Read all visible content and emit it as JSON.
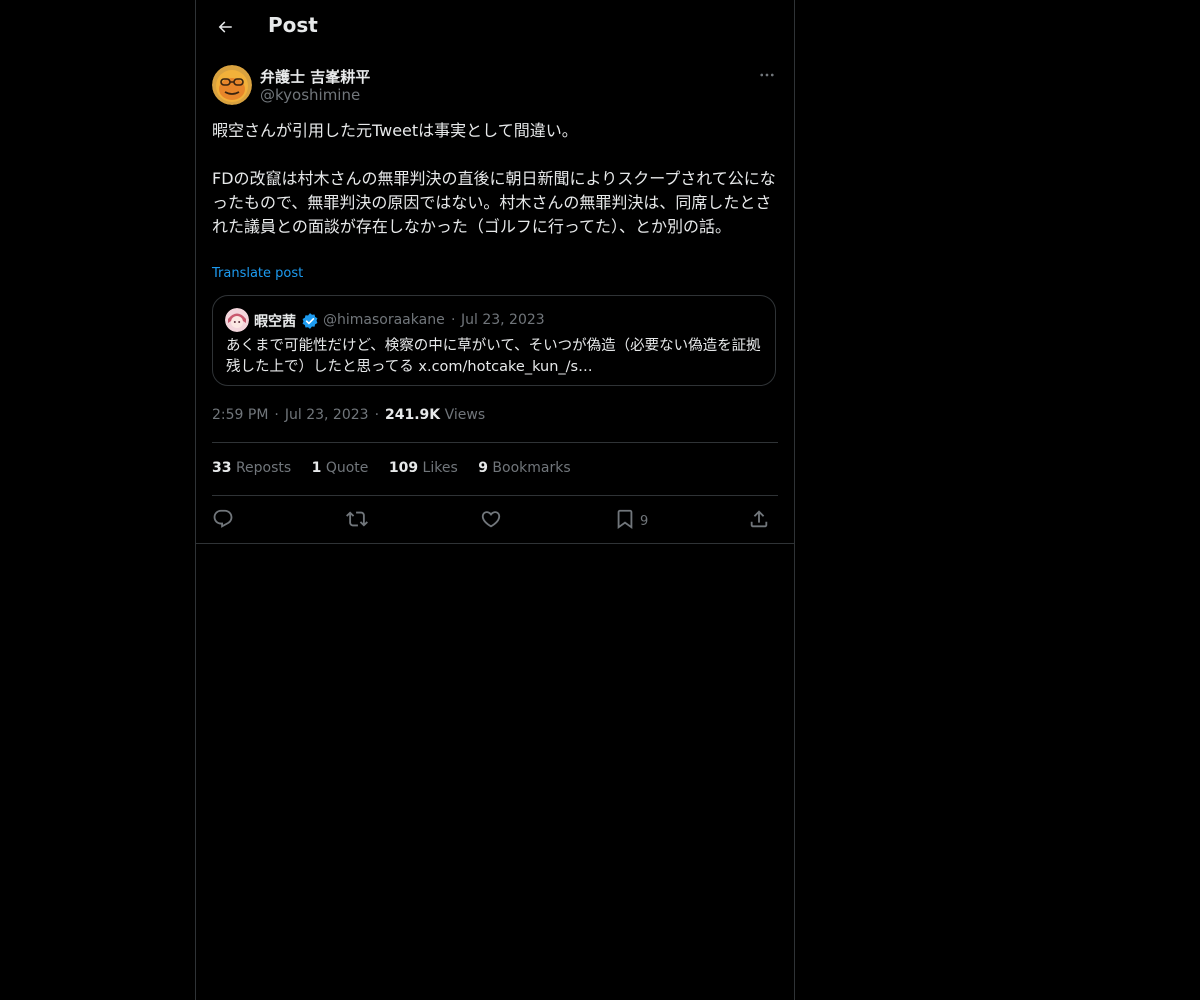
{
  "header": {
    "title": "Post"
  },
  "author": {
    "name": "弁護士 吉峯耕平",
    "handle": "@kyoshimine"
  },
  "tweet": {
    "text": "暇空さんが引用した元Tweetは事実として間違い。\n\nFDの改竄は村木さんの無罪判決の直後に朝日新聞によりスクープされて公になったもので、無罪判決の原因ではない。村木さんの無罪判決は、同席したとされた議員との面談が存在しなかった（ゴルフに行ってた）、とか別の話。",
    "translate_label": "Translate post"
  },
  "quote": {
    "name": "暇空茜",
    "handle": "@himasoraakane",
    "dot": "·",
    "date": "Jul 23, 2023",
    "text": "あくまで可能性だけど、検察の中に草がいて、そいつが偽造（必要ない偽造を証拠残した上で）したと思ってる x.com/hotcake_kun_/s…"
  },
  "meta": {
    "time": "2:59 PM",
    "dot": "·",
    "date": "Jul 23, 2023",
    "views_count": "241.9K",
    "views_label": "Views"
  },
  "stats": {
    "reposts_count": "33",
    "reposts_label": "Reposts",
    "quotes_count": "1",
    "quotes_label": "Quote",
    "likes_count": "109",
    "likes_label": "Likes",
    "bookmarks_count": "9",
    "bookmarks_label": "Bookmarks"
  },
  "actions": {
    "bookmark_count": "9"
  },
  "colors": {
    "background": "#000000",
    "text": "#e7e9ea",
    "secondary": "#71767b",
    "border": "#2f3336",
    "accent": "#1d9bf0"
  },
  "icons": {
    "back": "arrow-left-icon",
    "more": "more-icon",
    "verified": "verified-icon",
    "reply": "reply-icon",
    "repost": "repost-icon",
    "like": "heart-icon",
    "bookmark": "bookmark-icon",
    "share": "share-icon"
  }
}
